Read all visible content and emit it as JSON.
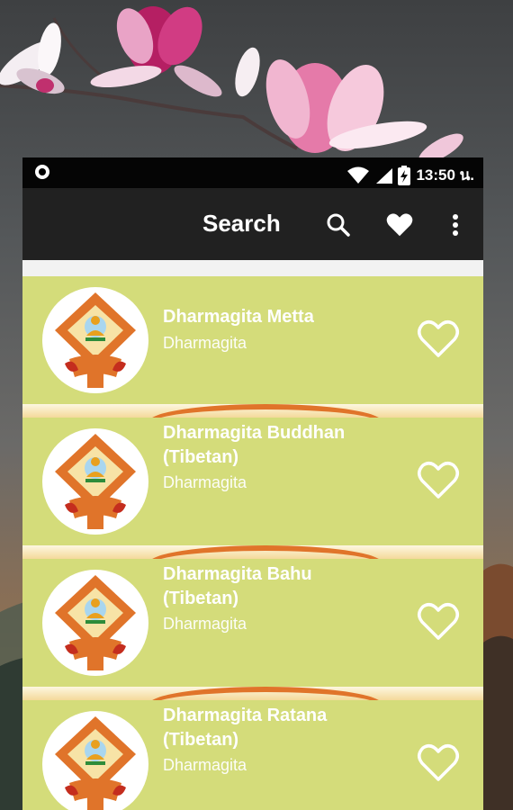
{
  "status_bar": {
    "time": "13:50 น."
  },
  "toolbar": {
    "title": "Search",
    "icons": [
      "search-icon",
      "heart-filled-icon",
      "more-vert-icon"
    ]
  },
  "items": [
    {
      "title": "Dharmagita Metta",
      "subtitle": "Dharmagita"
    },
    {
      "title": "Dharmagita Buddhan (Tibetan)",
      "subtitle": "Dharmagita"
    },
    {
      "title": "Dharmagita Bahu (Tibetan)",
      "subtitle": "Dharmagita"
    },
    {
      "title": "Dharmagita Ratana (Tibetan)",
      "subtitle": "Dharmagita"
    }
  ],
  "colors": {
    "card": "#d4dc7a",
    "toolbar": "#212121",
    "status_bar": "#050505"
  }
}
